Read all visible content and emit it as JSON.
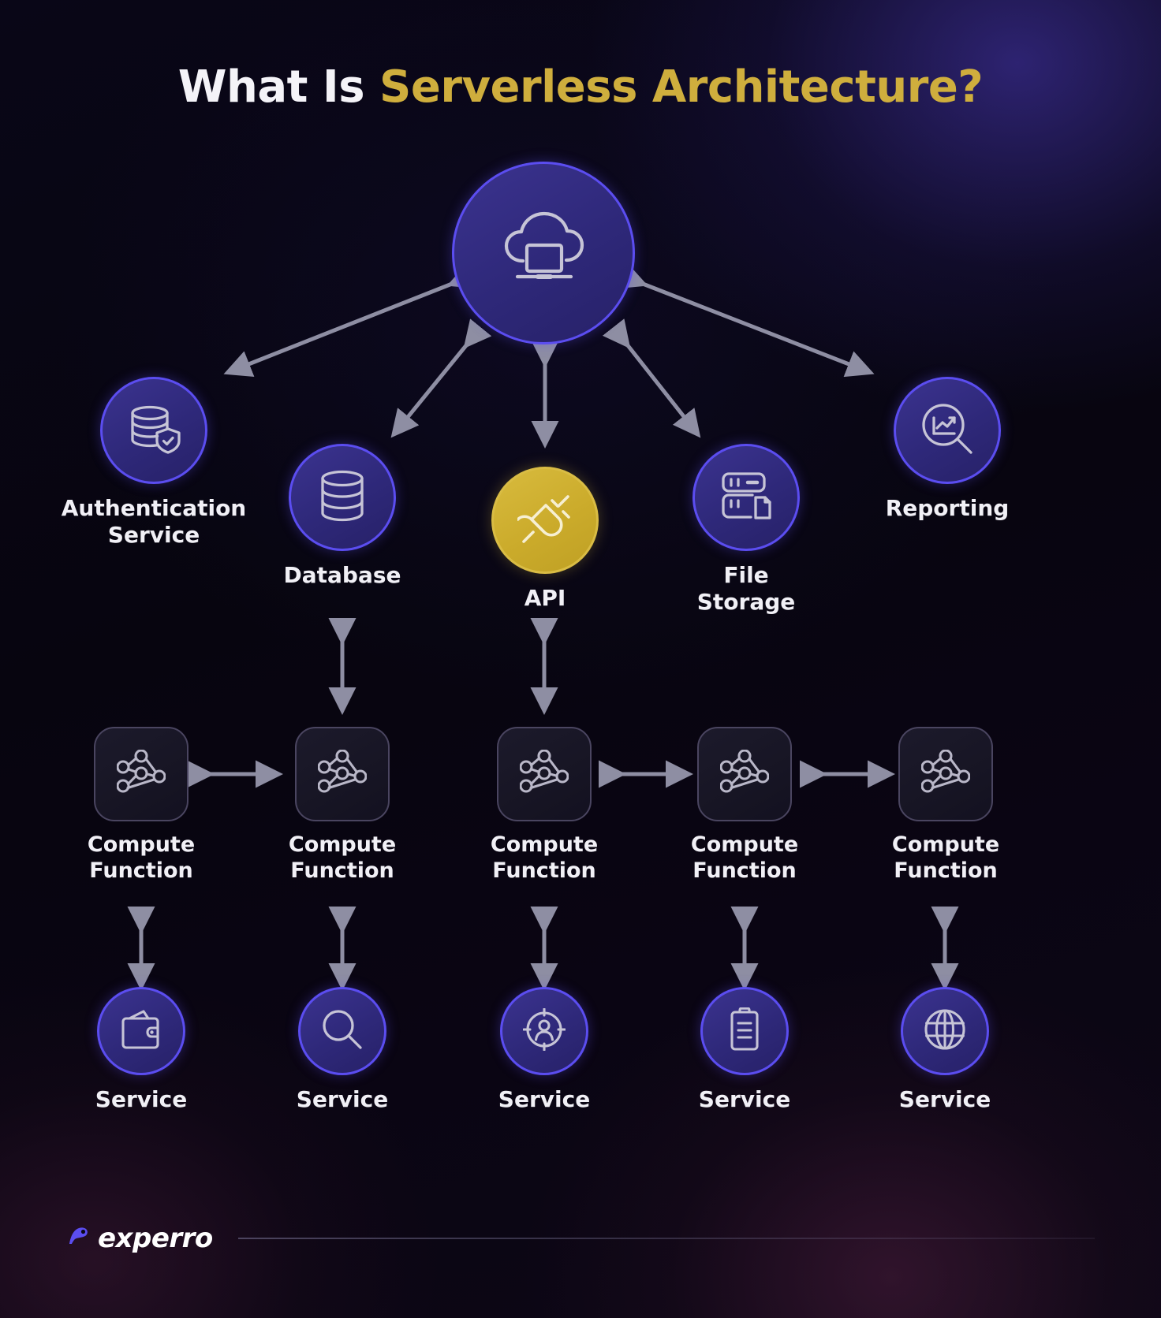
{
  "title": {
    "part_white": "What Is ",
    "part_gold": "Serverless Architecture?"
  },
  "colors": {
    "background": "#07050f",
    "node_fill": "#2e2879",
    "node_border": "#5b4df0",
    "accent_gold": "#cbab2b",
    "title_gold": "#cfae3d",
    "text": "#f1f0f6",
    "arrow": "#8e8ea3",
    "box_fill": "#171524",
    "box_border": "#4a4560"
  },
  "center_node": {
    "label": "",
    "icon": "cloud-laptop-icon"
  },
  "tier_services": [
    {
      "label": "Authentication\nService",
      "icon": "database-shield-icon",
      "color": "purple"
    },
    {
      "label": "Database",
      "icon": "database-icon",
      "color": "purple"
    },
    {
      "label": "API",
      "icon": "plug-connector-icon",
      "color": "gold"
    },
    {
      "label": "File\nStorage",
      "icon": "server-rack-icon",
      "color": "purple"
    },
    {
      "label": "Reporting",
      "icon": "chart-magnifier-icon",
      "color": "purple"
    }
  ],
  "tier_compute": [
    {
      "label": "Compute\nFunction",
      "icon": "network-nodes-icon"
    },
    {
      "label": "Compute\nFunction",
      "icon": "network-nodes-icon"
    },
    {
      "label": "Compute\nFunction",
      "icon": "network-nodes-icon"
    },
    {
      "label": "Compute\nFunction",
      "icon": "network-nodes-icon"
    },
    {
      "label": "Compute\nFunction",
      "icon": "network-nodes-icon"
    }
  ],
  "tier_leaf": [
    {
      "label": "Service",
      "icon": "wallet-icon"
    },
    {
      "label": "Service",
      "icon": "search-icon"
    },
    {
      "label": "Service",
      "icon": "user-target-icon"
    },
    {
      "label": "Service",
      "icon": "clipboard-icon"
    },
    {
      "label": "Service",
      "icon": "globe-icon"
    }
  ],
  "footer": {
    "brand": "experro",
    "logo_icon": "experro-mark-icon"
  }
}
